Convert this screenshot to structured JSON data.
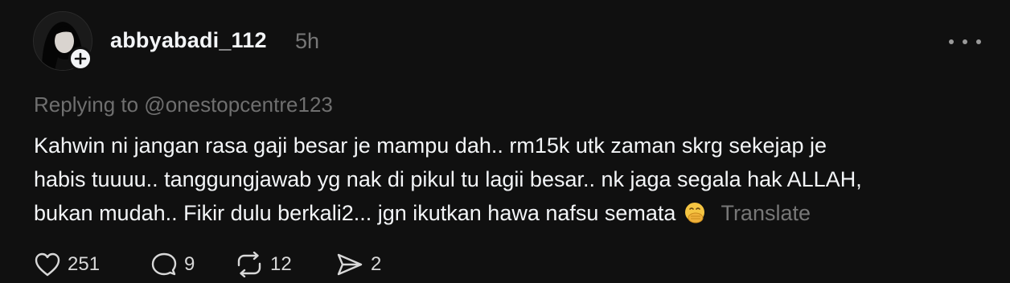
{
  "post": {
    "username": "abbyabadi_112",
    "timestamp": "5h",
    "replying_to": "Replying to @onestopcentre123",
    "text_lines": [
      "Kahwin ni jangan rasa gaji besar je mampu dah.. rm15k utk zaman skrg sekejap je",
      "habis tuuuu.. tanggungjawab yg nak di pikul tu lagii besar.. nk jaga segala hak ALLAH,",
      "bukan mudah.. Fikir dulu berkali2... jgn ikutkan hawa nafsu semata"
    ],
    "emoji": "face-with-hand-over-mouth",
    "translate_label": "Translate"
  },
  "actions": {
    "likes": "251",
    "replies": "9",
    "reposts": "12",
    "shares": "2"
  },
  "icons": {
    "avatar": "avatar-photo",
    "follow": "plus-icon",
    "more": "more-icon",
    "like": "heart-icon",
    "reply": "comment-icon",
    "repost": "repost-icon",
    "share": "send-icon"
  },
  "colors": {
    "background": "#101010",
    "text": "#f3f5f7",
    "muted": "#777777"
  }
}
